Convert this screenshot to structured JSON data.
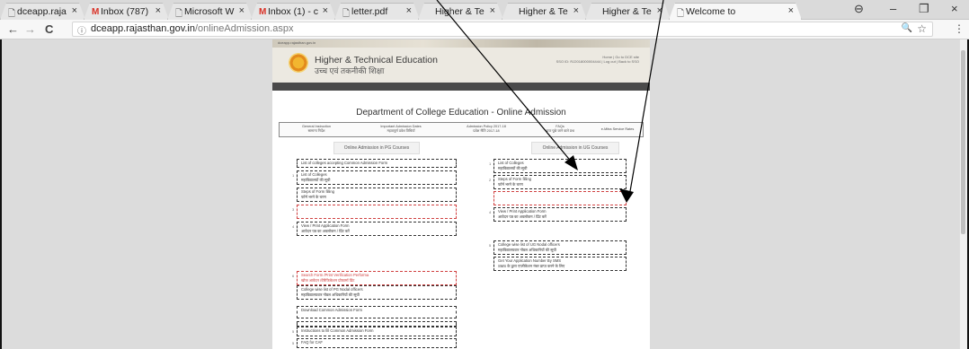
{
  "tabs": [
    {
      "label": "dceapp.raja",
      "icon": "doc"
    },
    {
      "label": "Inbox (787)",
      "icon": "gmail"
    },
    {
      "label": "Microsoft W",
      "icon": "doc"
    },
    {
      "label": "Inbox (1) - c",
      "icon": "gmail"
    },
    {
      "label": "letter.pdf",
      "icon": "doc"
    },
    {
      "label": "Higher & Te",
      "icon": ""
    },
    {
      "label": "Higher & Te",
      "icon": ""
    },
    {
      "label": "Higher & Te",
      "icon": ""
    },
    {
      "label": "Welcome to",
      "icon": "doc"
    }
  ],
  "glyphs": {
    "close": "×",
    "doc": "🗋",
    "gmail": "M",
    "back": "←",
    "forward": "→",
    "reload": "C",
    "info": "ⓘ",
    "zoom": "🔍",
    "star": "☆",
    "menu": "⋮",
    "profile": "⊖",
    "minimize": "–",
    "maximize": "❐",
    "window_close": "×"
  },
  "address": {
    "host": "dceapp.rajasthan.gov.in",
    "path": "/onlineAdmission.aspx"
  },
  "site": {
    "banner_url": "dceapp.rajasthan.gov.in",
    "title": "Higher & Technical Education",
    "subtitle": "उच्च एवं तकनीकी शिक्षा",
    "welcome_line1": "Home | Go to DCE site",
    "welcome_line2": "SSO ID: RJ2018000004444 | Log out | Back to SSO",
    "heading": "Department of College Education - Online Admission"
  },
  "infobar": [
    {
      "en": "General Instruction",
      "hi": "सामान्य निर्देश"
    },
    {
      "en": "Important Admission Dates",
      "hi": "महत्वपूर्ण प्रवेश तिथियाँ"
    },
    {
      "en": "Admission Policy 2017-18",
      "hi": "प्रवेश नीति 2017-18"
    },
    {
      "en": "FAQs",
      "hi": "प्रायः पूछे जाने वाले प्रश्न"
    },
    {
      "en": "e-Mitra Service Rates",
      "hi": ""
    }
  ],
  "pg_header": "Online Admission in PG Courses",
  "ug_header": "Online Admission in UG Courses",
  "pg_links": [
    {
      "num": "",
      "en": "List of colleges accepting Common Admission Form",
      "hi": "",
      "red": false
    },
    {
      "num": "1",
      "en": "List of Colleges",
      "hi": "महाविद्यालयों की सूची",
      "red": false
    },
    {
      "num": "",
      "en": "Steps of Form filling",
      "hi": "फॉर्म भरने के चरण",
      "red": false
    },
    {
      "num": "3",
      "en": "",
      "hi": "",
      "red": true
    },
    {
      "num": "4",
      "en": "View / Print Application Form",
      "hi": "आवेदन पत्र का अवलोकन / प्रिंट करें",
      "red": false
    },
    {
      "num": "6",
      "en": "Search Form /Print Verification Performa",
      "hi": "खोज आवेदन /वेरिफिकेशन प्रोफार्मा प्रिंट",
      "red": true
    },
    {
      "num": "",
      "en": "College wise list of PG Nodal officers",
      "hi": "महाविद्यालयवार नोडल अधिकारियों की सूची",
      "red": false
    },
    {
      "num": "",
      "en": "Download Common Admission Form",
      "hi": "",
      "red": false
    },
    {
      "num": "",
      "en": "",
      "hi": "",
      "red": false
    },
    {
      "num": "5",
      "en": "Instructions to fill Common Admission Form",
      "hi": "",
      "red": false
    },
    {
      "num": "5",
      "en": "FAQ for CAF",
      "hi": "",
      "red": false
    }
  ],
  "ug_links": [
    {
      "num": "1",
      "en": "List of Colleges",
      "hi": "महाविद्यालयों की सूची",
      "red": false
    },
    {
      "num": "2",
      "en": "Steps of Form filling",
      "hi": "फॉर्म भरने के चरण",
      "red": false
    },
    {
      "num": "",
      "en": "",
      "hi": "",
      "red": true
    },
    {
      "num": "4",
      "en": "View / Print Application Form",
      "hi": "आवेदन पत्र का अवलोकन / प्रिंट करें",
      "red": false
    },
    {
      "num": "5",
      "en": "College wise list of UG Nodal officers",
      "hi": "महाविद्यालयवार नोडल अधिकारियों की सूची",
      "red": false
    },
    {
      "num": "",
      "en": "Get Your Application Number By SMS",
      "hi": "SMS के द्वारा एप्लीकेशन नंबर प्राप्त करने के लिए",
      "red": false
    }
  ]
}
